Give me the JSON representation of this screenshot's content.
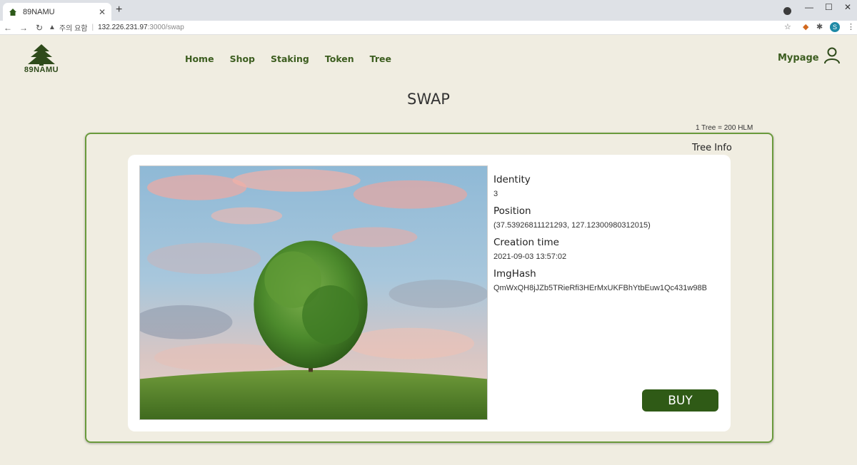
{
  "browser": {
    "tab_title": "89NAMU",
    "url_warning": "주의 요함",
    "url_host": "132.226.231.97",
    "url_path": ":3000/swap",
    "profile_initial": "S"
  },
  "site": {
    "logo_text": "89NAMU",
    "nav": [
      "Home",
      "Shop",
      "Staking",
      "Token",
      "Tree"
    ],
    "mypage": "Mypage"
  },
  "swap": {
    "title": "SWAP",
    "rate": "1 Tree = 200 HLM",
    "panel_label": "Tree Info",
    "fields": [
      {
        "label": "Identity",
        "value": "3"
      },
      {
        "label": "Position",
        "value": "(37.53926811121293, 127.12300980312015)"
      },
      {
        "label": "Creation time",
        "value": "2021-09-03 13:57:02"
      },
      {
        "label": "ImgHash",
        "value": "QmWxQH8jJZb5TRieRfi3HErMxUKFBhYtbEuw1Qc431w98B"
      }
    ],
    "buy_label": "BUY"
  },
  "colors": {
    "brand_green": "#3c5d1f",
    "button_green": "#2f5a16",
    "border_green": "#6a9a3c",
    "page_bg": "#f0ede1"
  }
}
